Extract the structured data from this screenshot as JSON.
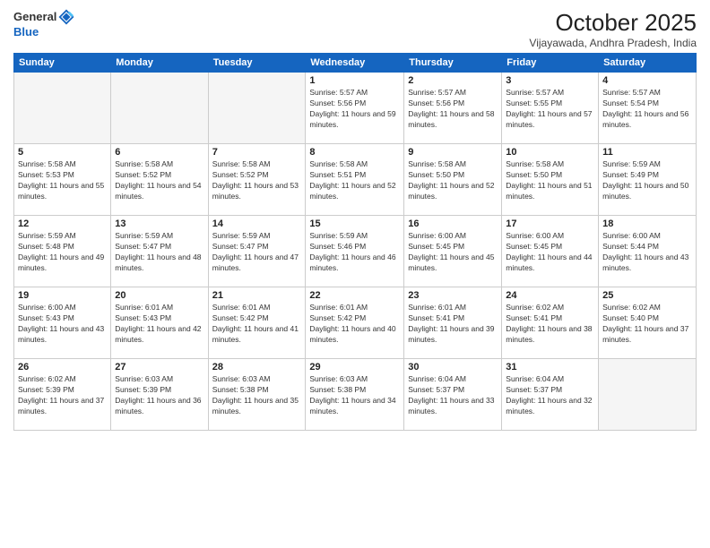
{
  "header": {
    "logo_general": "General",
    "logo_blue": "Blue",
    "title": "October 2025",
    "subtitle": "Vijayawada, Andhra Pradesh, India"
  },
  "weekdays": [
    "Sunday",
    "Monday",
    "Tuesday",
    "Wednesday",
    "Thursday",
    "Friday",
    "Saturday"
  ],
  "weeks": [
    [
      {
        "day": "",
        "empty": true
      },
      {
        "day": "",
        "empty": true
      },
      {
        "day": "",
        "empty": true
      },
      {
        "day": "1",
        "sunrise": "5:57 AM",
        "sunset": "5:56 PM",
        "daylight": "11 hours and 59 minutes."
      },
      {
        "day": "2",
        "sunrise": "5:57 AM",
        "sunset": "5:56 PM",
        "daylight": "11 hours and 58 minutes."
      },
      {
        "day": "3",
        "sunrise": "5:57 AM",
        "sunset": "5:55 PM",
        "daylight": "11 hours and 57 minutes."
      },
      {
        "day": "4",
        "sunrise": "5:57 AM",
        "sunset": "5:54 PM",
        "daylight": "11 hours and 56 minutes."
      }
    ],
    [
      {
        "day": "5",
        "sunrise": "5:58 AM",
        "sunset": "5:53 PM",
        "daylight": "11 hours and 55 minutes."
      },
      {
        "day": "6",
        "sunrise": "5:58 AM",
        "sunset": "5:52 PM",
        "daylight": "11 hours and 54 minutes."
      },
      {
        "day": "7",
        "sunrise": "5:58 AM",
        "sunset": "5:52 PM",
        "daylight": "11 hours and 53 minutes."
      },
      {
        "day": "8",
        "sunrise": "5:58 AM",
        "sunset": "5:51 PM",
        "daylight": "11 hours and 52 minutes."
      },
      {
        "day": "9",
        "sunrise": "5:58 AM",
        "sunset": "5:50 PM",
        "daylight": "11 hours and 52 minutes."
      },
      {
        "day": "10",
        "sunrise": "5:58 AM",
        "sunset": "5:50 PM",
        "daylight": "11 hours and 51 minutes."
      },
      {
        "day": "11",
        "sunrise": "5:59 AM",
        "sunset": "5:49 PM",
        "daylight": "11 hours and 50 minutes."
      }
    ],
    [
      {
        "day": "12",
        "sunrise": "5:59 AM",
        "sunset": "5:48 PM",
        "daylight": "11 hours and 49 minutes."
      },
      {
        "day": "13",
        "sunrise": "5:59 AM",
        "sunset": "5:47 PM",
        "daylight": "11 hours and 48 minutes."
      },
      {
        "day": "14",
        "sunrise": "5:59 AM",
        "sunset": "5:47 PM",
        "daylight": "11 hours and 47 minutes."
      },
      {
        "day": "15",
        "sunrise": "5:59 AM",
        "sunset": "5:46 PM",
        "daylight": "11 hours and 46 minutes."
      },
      {
        "day": "16",
        "sunrise": "6:00 AM",
        "sunset": "5:45 PM",
        "daylight": "11 hours and 45 minutes."
      },
      {
        "day": "17",
        "sunrise": "6:00 AM",
        "sunset": "5:45 PM",
        "daylight": "11 hours and 44 minutes."
      },
      {
        "day": "18",
        "sunrise": "6:00 AM",
        "sunset": "5:44 PM",
        "daylight": "11 hours and 43 minutes."
      }
    ],
    [
      {
        "day": "19",
        "sunrise": "6:00 AM",
        "sunset": "5:43 PM",
        "daylight": "11 hours and 43 minutes."
      },
      {
        "day": "20",
        "sunrise": "6:01 AM",
        "sunset": "5:43 PM",
        "daylight": "11 hours and 42 minutes."
      },
      {
        "day": "21",
        "sunrise": "6:01 AM",
        "sunset": "5:42 PM",
        "daylight": "11 hours and 41 minutes."
      },
      {
        "day": "22",
        "sunrise": "6:01 AM",
        "sunset": "5:42 PM",
        "daylight": "11 hours and 40 minutes."
      },
      {
        "day": "23",
        "sunrise": "6:01 AM",
        "sunset": "5:41 PM",
        "daylight": "11 hours and 39 minutes."
      },
      {
        "day": "24",
        "sunrise": "6:02 AM",
        "sunset": "5:41 PM",
        "daylight": "11 hours and 38 minutes."
      },
      {
        "day": "25",
        "sunrise": "6:02 AM",
        "sunset": "5:40 PM",
        "daylight": "11 hours and 37 minutes."
      }
    ],
    [
      {
        "day": "26",
        "sunrise": "6:02 AM",
        "sunset": "5:39 PM",
        "daylight": "11 hours and 37 minutes."
      },
      {
        "day": "27",
        "sunrise": "6:03 AM",
        "sunset": "5:39 PM",
        "daylight": "11 hours and 36 minutes."
      },
      {
        "day": "28",
        "sunrise": "6:03 AM",
        "sunset": "5:38 PM",
        "daylight": "11 hours and 35 minutes."
      },
      {
        "day": "29",
        "sunrise": "6:03 AM",
        "sunset": "5:38 PM",
        "daylight": "11 hours and 34 minutes."
      },
      {
        "day": "30",
        "sunrise": "6:04 AM",
        "sunset": "5:37 PM",
        "daylight": "11 hours and 33 minutes."
      },
      {
        "day": "31",
        "sunrise": "6:04 AM",
        "sunset": "5:37 PM",
        "daylight": "11 hours and 32 minutes."
      },
      {
        "day": "",
        "empty": true
      }
    ]
  ]
}
